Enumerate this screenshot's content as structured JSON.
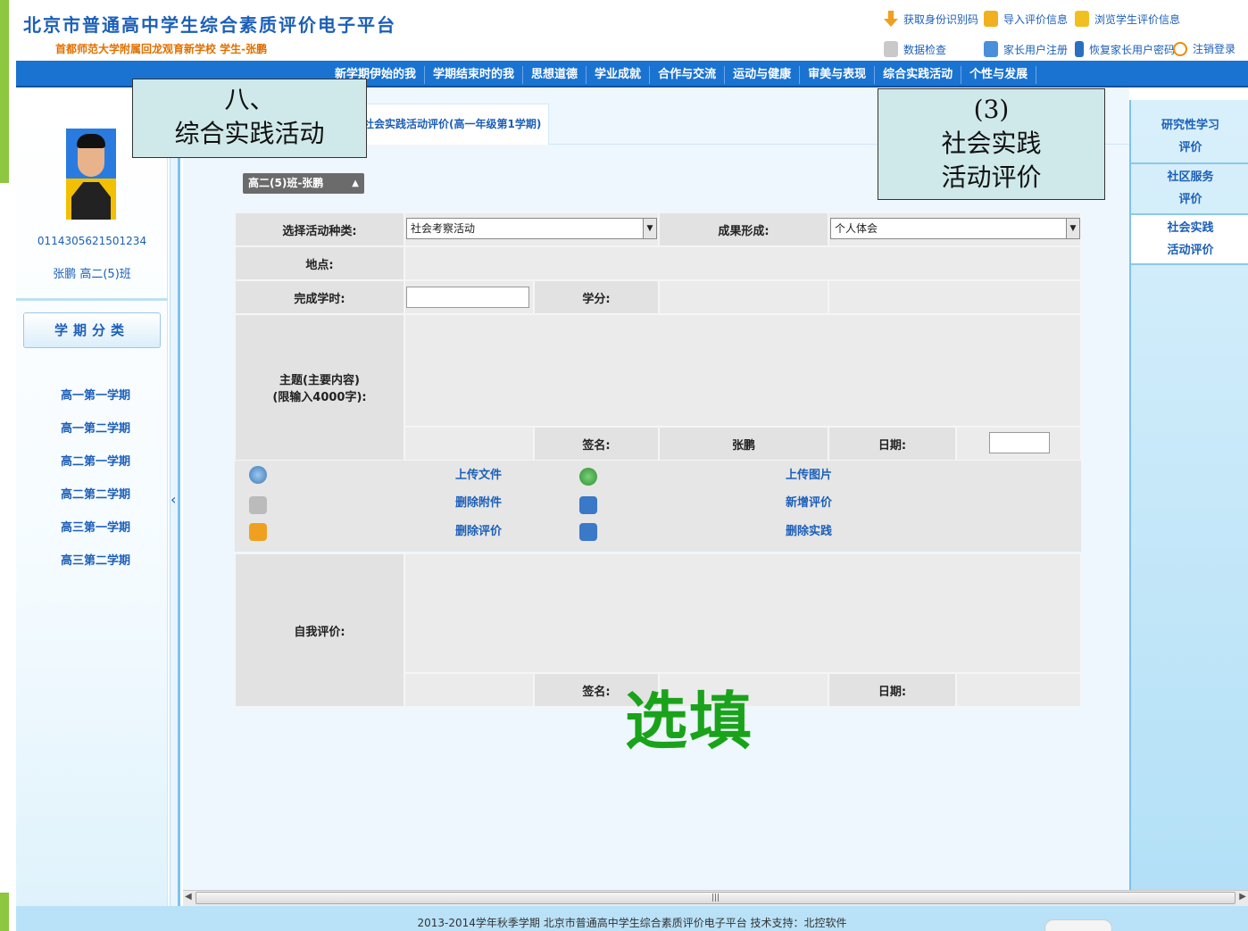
{
  "header": {
    "title": "北京市普通高中学生综合素质评价电子平台",
    "subtitle": "首都师范大学附属回龙观育新学校 学生-张鹏",
    "links": [
      {
        "label": "获取身份识别码",
        "icon": "download-icon",
        "color": "#f0a020"
      },
      {
        "label": "导入评价信息",
        "icon": "import-icon",
        "color": "#f0b020"
      },
      {
        "label": "浏览学生评价信息",
        "icon": "browse-icon",
        "color": "#f0c020"
      },
      {
        "label": "数据检查",
        "icon": "check-icon",
        "color": "#9a9a9a"
      },
      {
        "label": "家长用户注册",
        "icon": "register-icon",
        "color": "#4a8fd9"
      },
      {
        "label": "恢复家长用户密码",
        "icon": "restore-icon",
        "color": "#2a6fc0"
      },
      {
        "label": "注销登录",
        "icon": "logout-icon",
        "color": "#f08a00"
      }
    ]
  },
  "nav": {
    "items": [
      "新学期伊始的我",
      "学期结束时的我",
      "思想道德",
      "学业成就",
      "合作与交流",
      "运动与健康",
      "审美与表现",
      "综合实践活动",
      "个性与发展"
    ],
    "accent": "#1a73d1"
  },
  "student": {
    "id": "011430562150123 4",
    "id_text": "0114305621501234",
    "class": "张鹏 高二(5)班"
  },
  "sidebar": {
    "category_label": "学期分类",
    "terms": [
      "高一第一学期",
      "高一第二学期",
      "高二第一学期",
      "高二第二学期",
      "高三第一学期",
      "高三第二学期"
    ]
  },
  "tab": {
    "active_label": "社会实践活动评价(高一年级第1学期)"
  },
  "student_chip": "高二(5)班-张鹏",
  "form": {
    "activity_type_label": "选择活动种类:",
    "activity_type_value": "社会考察活动",
    "result_form_label": "成果形成:",
    "result_form_value": "个人体会",
    "location_label": "地点:",
    "hours_label": "完成学时:",
    "credit_label": "学分:",
    "theme_label_1": "主题(主要内容)",
    "theme_label_2": "(限输入4000字):",
    "sign_label": "签名:",
    "sign_value": "张鹏",
    "date_label": "日期:",
    "self_eval_label": "自我评价:",
    "sign_label_2": "签名:",
    "date_label_2": "日期:"
  },
  "actions": {
    "upload_file": "上传文件",
    "delete_attachment": "删除附件",
    "delete_eval": "删除评价",
    "upload_image": "上传图片",
    "add_eval": "新增评价",
    "delete_practice": "删除实践"
  },
  "annotations": {
    "note1_line1": "八、",
    "note1_line2": "综合实践活动",
    "note2_line1": "(3)",
    "note2_line2": "社会实践",
    "note2_line3": "活动评价",
    "optional": "选填"
  },
  "right_panel": {
    "items": [
      {
        "line1": "研究性学习",
        "line2": "评价"
      },
      {
        "line1": "社区服务",
        "line2": "评价"
      },
      {
        "line1": "社会实践",
        "line2": "活动评价"
      }
    ]
  },
  "footer": {
    "text": "2013-2014学年秋季学期 北京市普通高中学生综合素质评价电子平台 技术支持：北控软件"
  }
}
